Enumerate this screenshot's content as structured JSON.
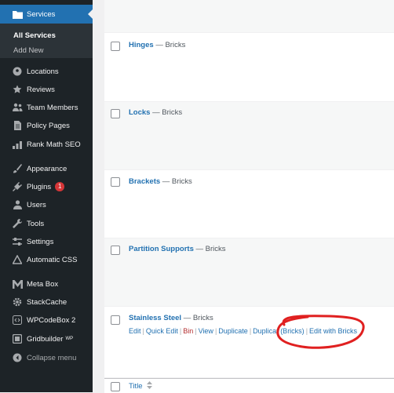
{
  "sidebar": {
    "active": {
      "label": "Services",
      "icon": "folder-icon"
    },
    "submenu": [
      {
        "label": "All Services",
        "current": true
      },
      {
        "label": "Add New",
        "current": false
      }
    ],
    "items": [
      {
        "label": "Locations",
        "icon": "pin-icon"
      },
      {
        "label": "Reviews",
        "icon": "star-icon"
      },
      {
        "label": "Team Members",
        "icon": "users-icon"
      },
      {
        "label": "Policy Pages",
        "icon": "page-icon"
      },
      {
        "label": "Rank Math SEO",
        "icon": "chart-icon"
      },
      {
        "label": "Appearance",
        "icon": "brush-icon"
      },
      {
        "label": "Plugins",
        "icon": "plug-icon",
        "badge": "1"
      },
      {
        "label": "Users",
        "icon": "user-icon"
      },
      {
        "label": "Tools",
        "icon": "wrench-icon"
      },
      {
        "label": "Settings",
        "icon": "sliders-icon"
      },
      {
        "label": "Automatic CSS",
        "icon": "triangle-icon"
      },
      {
        "label": "Meta Box",
        "icon": "m-icon"
      },
      {
        "label": "StackCache",
        "icon": "cog-icon"
      },
      {
        "label": "WPCodeBox 2",
        "icon": "code-icon"
      },
      {
        "label": "Gridbuilder",
        "icon": "grid-icon",
        "sup": "WP"
      }
    ],
    "collapse_label": "Collapse menu"
  },
  "rows": [
    {
      "title": "Hinges",
      "suffix": " — Bricks"
    },
    {
      "title": "Locks",
      "suffix": " — Bricks"
    },
    {
      "title": "Brackets",
      "suffix": " — Bricks"
    },
    {
      "title": "Partition Supports",
      "suffix": " — Bricks"
    },
    {
      "title": "Stainless Steel",
      "suffix": " — Bricks"
    }
  ],
  "row_actions": {
    "edit": "Edit",
    "quick_edit": "Quick Edit",
    "bin": "Bin",
    "view": "View",
    "duplicate": "Duplicate",
    "duplicate_bricks": "Duplicat",
    "bricks_tag": "(Bricks)",
    "edit_with_bricks": "Edit with Bricks"
  },
  "table_header": {
    "title": "Title",
    "sort_icon": "sort-icon"
  },
  "colors": {
    "accent": "#2271b1",
    "sidebar": "#1d2327",
    "annotation": "#e02020",
    "badge": "#d63638"
  }
}
